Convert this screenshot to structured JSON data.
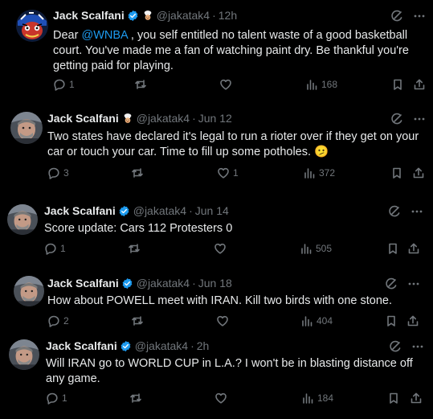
{
  "tweets": [
    {
      "name": "Jack Scalfani",
      "handle": "@jakatak4",
      "time": "12h",
      "text_parts": [
        "Dear ",
        "@WNBA",
        " , you self entitled no talent waste of a good basketball court. You've made me a fan of watching paint dry.  Be thankful you're getting paid for playing."
      ],
      "replies": "1",
      "retweets": "",
      "likes": "",
      "views": "168",
      "has_emoji_badge": true
    },
    {
      "name": "Jack Scalfani",
      "handle": "@jakatak4",
      "time": "Jun 12",
      "text": "Two states have declared it's legal to run a rioter over if they get on your car or touch your car. Time to fill up some potholes. 🫤",
      "replies": "3",
      "retweets": "",
      "likes": "1",
      "views": "372",
      "has_emoji_badge": true
    },
    {
      "name": "Jack Scalfani",
      "handle": "@jakatak4",
      "time": "Jun 14",
      "text": "Score update: Cars 112 Protesters 0",
      "replies": "1",
      "retweets": "",
      "likes": "",
      "views": "505",
      "has_emoji_badge": false
    },
    {
      "name": "Jack Scalfani",
      "handle": "@jakatak4",
      "time": "Jun 18",
      "text": "How about POWELL meet with IRAN. Kill two birds with one stone.",
      "replies": "2",
      "retweets": "",
      "likes": "",
      "views": "404",
      "has_emoji_badge": false
    },
    {
      "name": "Jack Scalfani",
      "handle": "@jakatak4",
      "time": "2h",
      "text": "Will IRAN go to WORLD CUP in L.A.? I won't be in blasting distance off any game.",
      "replies": "1",
      "retweets": "",
      "likes": "",
      "views": "184",
      "has_emoji_badge": false
    }
  ],
  "dot_separator": "·",
  "colors": {
    "background": "#000000",
    "text": "#e7e9ea",
    "muted": "#71767b",
    "link": "#1d9bf0",
    "verified": "#1d9bf0",
    "divider": "#2f3336"
  },
  "icons": [
    "grok-icon",
    "more-icon",
    "reply-icon",
    "retweet-icon",
    "like-icon",
    "views-icon",
    "bookmark-icon",
    "share-icon",
    "verified-badge-icon"
  ]
}
